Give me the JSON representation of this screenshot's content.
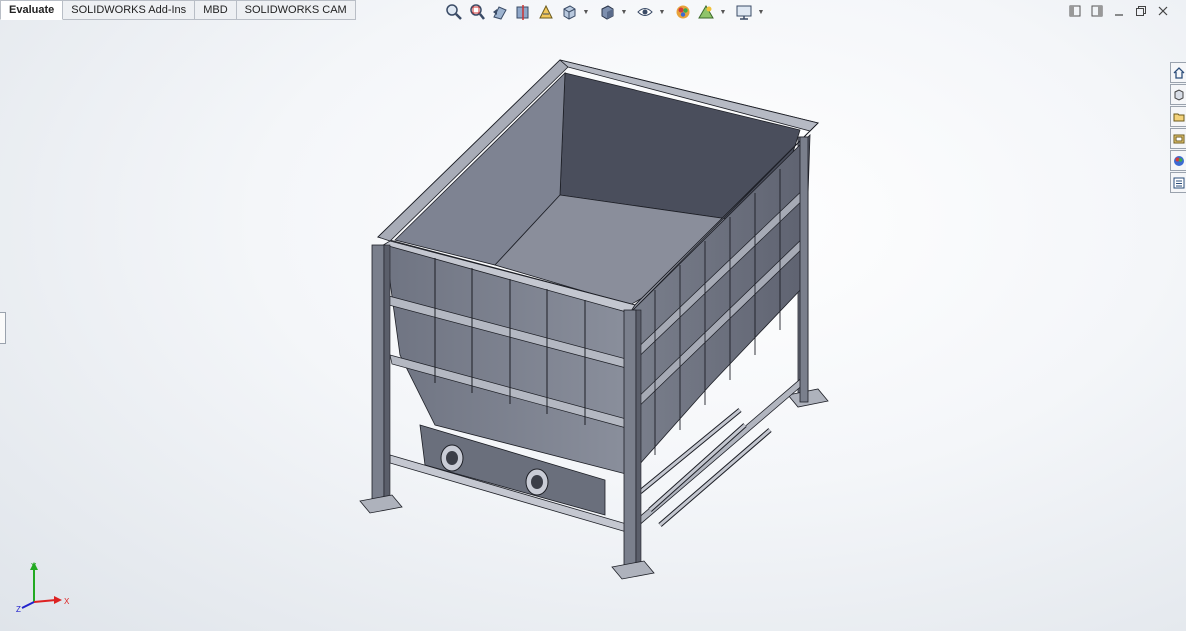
{
  "tabs": [
    {
      "label": "Evaluate",
      "active": true
    },
    {
      "label": "SOLIDWORKS Add-Ins",
      "active": false
    },
    {
      "label": "MBD",
      "active": false
    },
    {
      "label": "SOLIDWORKS CAM",
      "active": false
    }
  ],
  "heads_up_toolbar": [
    "zoom-to-fit-icon",
    "zoom-to-area-icon",
    "previous-view-icon",
    "section-view-icon",
    "dynamic-annotation-icon",
    "view-orientation-icon",
    "display-style-icon",
    "hide-show-items-icon",
    "edit-appearance-icon",
    "apply-scene-icon",
    "view-settings-icon"
  ],
  "window_controls": [
    "tile-left-icon",
    "tile-right-icon",
    "minimize-icon",
    "restore-icon",
    "close-icon"
  ],
  "task_pane": [
    "home-icon",
    "parts-library-icon",
    "file-explorer-icon",
    "view-palette-icon",
    "appearances-icon",
    "custom-properties-icon"
  ],
  "triad": {
    "x": "X",
    "y": "Y",
    "z": "Z"
  },
  "colors": {
    "steel": "#7f8492",
    "steel_dark": "#4a4e5c",
    "steel_light": "#c9ccd6",
    "edge": "#1d1f26",
    "axis_x": "#d22",
    "axis_y": "#2a2",
    "axis_z": "#22c"
  }
}
